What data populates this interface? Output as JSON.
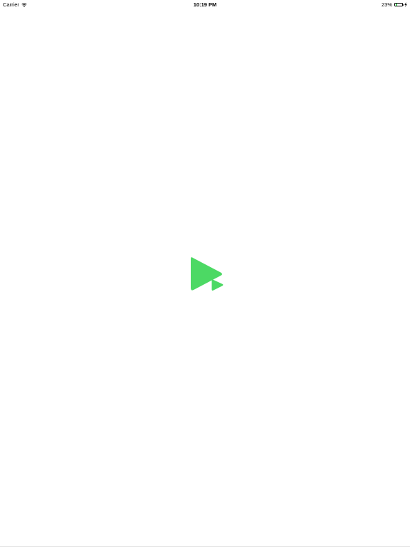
{
  "status_bar": {
    "carrier": "Carrier",
    "wifi_icon": "wifi-icon",
    "time": "10:19 PM",
    "battery_percent": "23%",
    "battery_level": 0.23,
    "battery_icon": "battery-icon",
    "charging_icon": "charging-bolt-icon"
  },
  "splash": {
    "logo_icon": "play-logo-icon",
    "accent_color": "#4cd964"
  }
}
